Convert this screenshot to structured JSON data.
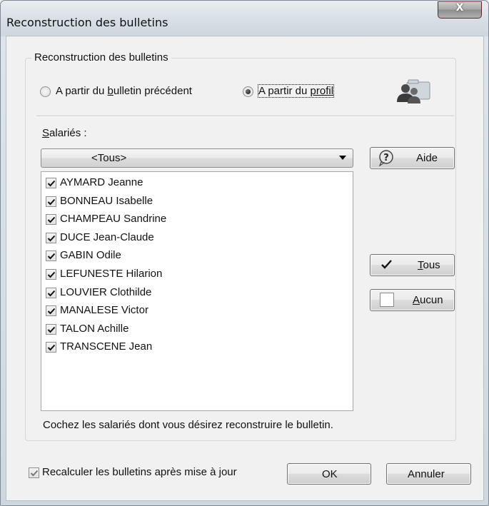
{
  "window": {
    "title": "Reconstruction des bulletins",
    "close_label": "X"
  },
  "group": {
    "legend": "Reconstruction des bulletins",
    "radio_previous": {
      "prefix": "A partir du ",
      "underlined": "b",
      "suffix": "ulletin précédent",
      "selected": false
    },
    "radio_profile": {
      "prefix": "A partir du ",
      "underlined": "profil",
      "selected": true
    },
    "employees_label": {
      "underlined": "S",
      "rest": "alariés :"
    },
    "combo": {
      "value": "<Tous>"
    },
    "employees": [
      {
        "name": "AYMARD Jeanne",
        "checked": true
      },
      {
        "name": "BONNEAU Isabelle",
        "checked": true
      },
      {
        "name": "CHAMPEAU Sandrine",
        "checked": true
      },
      {
        "name": "DUCE Jean-Claude",
        "checked": true
      },
      {
        "name": "GABIN Odile",
        "checked": true
      },
      {
        "name": "LEFUNESTE Hilarion",
        "checked": true
      },
      {
        "name": "LOUVIER Clothilde",
        "checked": true
      },
      {
        "name": "MANALESE Victor",
        "checked": true
      },
      {
        "name": "TALON Achille",
        "checked": true
      },
      {
        "name": "TRANSCENE Jean",
        "checked": true
      }
    ],
    "hint": "Cochez les salariés dont vous désirez reconstruire le bulletin."
  },
  "buttons": {
    "help": "Aide",
    "all": {
      "underlined": "T",
      "rest": "ous"
    },
    "none": {
      "underlined": "A",
      "rest": "ucun"
    },
    "ok": "OK",
    "cancel": "Annuler"
  },
  "recalc": {
    "label": "Recalculer les bulletins après mise à jour",
    "checked": true
  },
  "icons": [
    "profile-users-icon",
    "help-icon",
    "check-all-icon",
    "uncheck-all-icon"
  ]
}
